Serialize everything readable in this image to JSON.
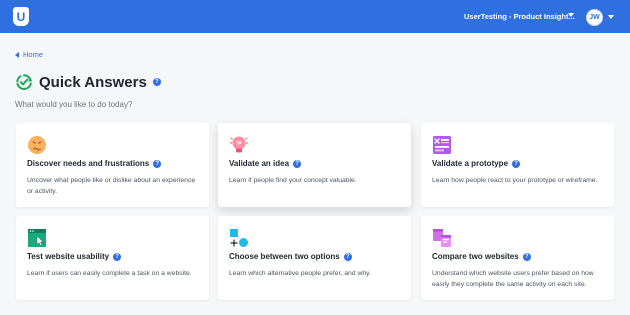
{
  "header": {
    "workspace": "UserTesting - Product Insight...",
    "avatar_initials": "JW",
    "logo_letter": "U",
    "brand_color": "#2f6fe0"
  },
  "nav": {
    "back_label": "Home"
  },
  "page": {
    "title": "Quick Answers",
    "subtitle": "What would you like to do today?"
  },
  "cards": [
    {
      "title": "Discover needs and frustrations",
      "description": "Uncover what people like or dislike about an experience or activity.",
      "icon": "frustrated-face-icon"
    },
    {
      "title": "Validate an idea",
      "description": "Learn if people find your concept valuable.",
      "icon": "lightbulb-icon"
    },
    {
      "title": "Validate a prototype",
      "description": "Learn how people react to your prototype or wireframe.",
      "icon": "prototype-icon"
    },
    {
      "title": "Test website usability",
      "description": "Learn if users can easily complete a task on a website.",
      "icon": "browser-cursor-icon"
    },
    {
      "title": "Choose between two options",
      "description": "Learn which alternative people prefer, and why.",
      "icon": "shapes-compare-icon"
    },
    {
      "title": "Compare two websites",
      "description": "Understand which website users prefer based on how easily they complete the same activity on each site.",
      "icon": "two-websites-icon"
    }
  ]
}
